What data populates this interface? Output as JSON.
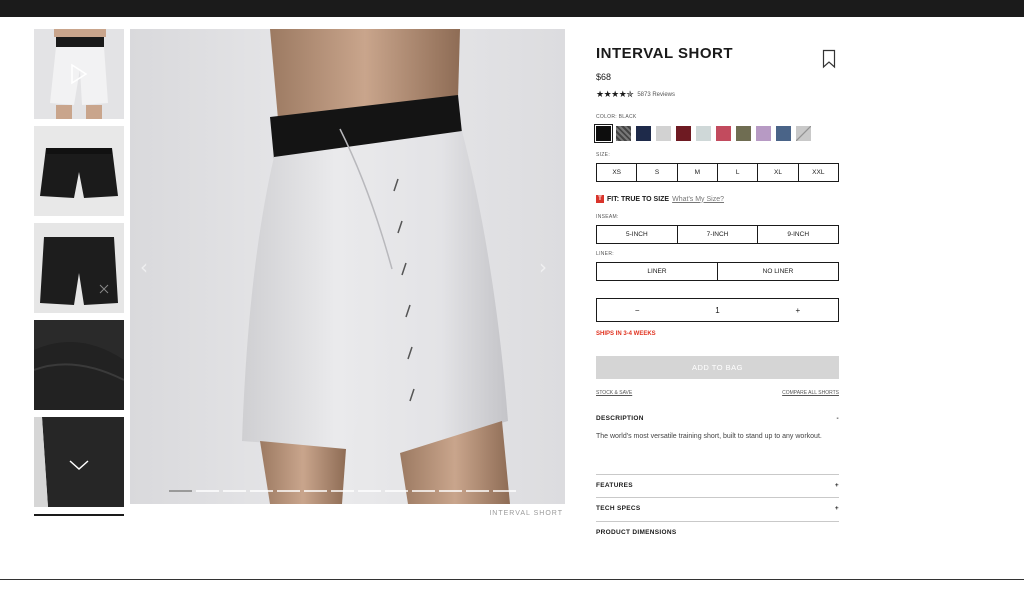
{
  "product": {
    "title": "INTERVAL SHORT",
    "price": "$68",
    "stars": "★★★★✯",
    "reviews": "5873 Reviews",
    "image_caption": "INTERVAL SHORT"
  },
  "color": {
    "label": "COLOR: BLACK",
    "swatches": [
      "#0d0d0d",
      "#5a5a5a",
      "#1e2a4a",
      "#d2d2d2",
      "#6e1a22",
      "#cfd8d8",
      "#c24b5e",
      "#6f6d52",
      "#b79ac4",
      "#4a6488",
      "#bdbdbd"
    ]
  },
  "size": {
    "label": "SIZE:",
    "options": [
      "XS",
      "S",
      "M",
      "L",
      "XL",
      "XXL"
    ]
  },
  "fit": {
    "badge": "T",
    "text": "FIT: TRUE TO SIZE",
    "link": "What's My Size?"
  },
  "inseam": {
    "label": "INSEAM:",
    "options": [
      "5-INCH",
      "7-INCH",
      "9-INCH"
    ]
  },
  "liner": {
    "label": "LINER:",
    "options": [
      "LINER",
      "NO LINER"
    ]
  },
  "quantity": {
    "minus": "−",
    "value": "1",
    "plus": "+"
  },
  "shipping": "SHIPS IN 3-4 WEEKS",
  "add_to_bag": "ADD TO BAG",
  "links": {
    "stock": "STOCK & SAVE",
    "compare": "COMPARE ALL SHORTS"
  },
  "description": {
    "title": "DESCRIPTION",
    "toggle": "-",
    "text": "The world's most versatile training short, built to stand up to any workout."
  },
  "features": {
    "title": "FEATURES",
    "toggle": "+"
  },
  "tech_specs": {
    "title": "TECH SPECS",
    "toggle": "+"
  },
  "dimensions": {
    "title": "PRODUCT DIMENSIONS"
  },
  "gallery": {
    "arrow_left": "‹",
    "arrow_right": "›",
    "slides": 13,
    "active_slide": 0
  },
  "colors": {
    "accent_red": "#e0321f",
    "add_bag_disabled": "#d5d5d5"
  }
}
